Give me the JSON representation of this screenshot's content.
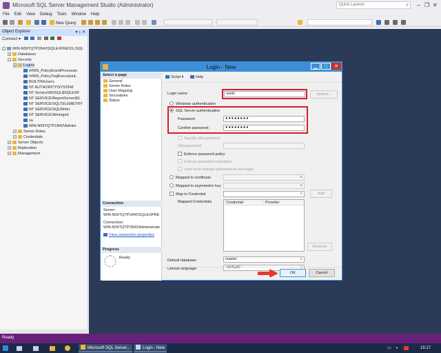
{
  "app": {
    "title": "Microsoft SQL Server Management Studio (Administrator)",
    "quick_launch_placeholder": "Quick Launch"
  },
  "menu": [
    "File",
    "Edit",
    "View",
    "Debug",
    "Tools",
    "Window",
    "Help"
  ],
  "toolbar": {
    "new_query_label": "New Query"
  },
  "object_explorer": {
    "title": "Object Explorer",
    "pin": "▾ ↨ ✕",
    "connect_label": "Connect ▾",
    "tree": [
      {
        "label": "WIN-N59TQTP1B42\\SQLEXPRESS (SQL",
        "indent": 0,
        "expander": "-",
        "icon": "server"
      },
      {
        "label": "Databases",
        "indent": 1,
        "expander": "+",
        "icon": "folder"
      },
      {
        "label": "Security",
        "indent": 1,
        "expander": "-",
        "icon": "folder"
      },
      {
        "label": "Logins",
        "indent": 2,
        "expander": "-",
        "icon": "folder",
        "selected": true
      },
      {
        "label": "##MS_PolicyEventProcessin",
        "indent": 3,
        "expander": "",
        "icon": "user"
      },
      {
        "label": "##MS_PolicyTsqlExecutionL",
        "indent": 3,
        "expander": "",
        "icon": "user"
      },
      {
        "label": "BUILTIN\\Users",
        "indent": 3,
        "expander": "",
        "icon": "user"
      },
      {
        "label": "NT AUTHORITY\\SYSTEM",
        "indent": 3,
        "expander": "",
        "icon": "user"
      },
      {
        "label": "NT Service\\MSSQL$SQLEXP",
        "indent": 3,
        "expander": "",
        "icon": "user"
      },
      {
        "label": "NT SERVICE\\ReportServer$S",
        "indent": 3,
        "expander": "",
        "icon": "user"
      },
      {
        "label": "NT SERVICE\\SQLTELEMETRY",
        "indent": 3,
        "expander": "",
        "icon": "user"
      },
      {
        "label": "NT SERVICE\\SQLWriter",
        "indent": 3,
        "expander": "",
        "icon": "user"
      },
      {
        "label": "NT SERVICE\\Winmgmt",
        "indent": 3,
        "expander": "",
        "icon": "user"
      },
      {
        "label": "sa",
        "indent": 3,
        "expander": "",
        "icon": "user"
      },
      {
        "label": "WIN-N59TQTP1B42\\Admini",
        "indent": 3,
        "expander": "",
        "icon": "user"
      },
      {
        "label": "Server Roles",
        "indent": 2,
        "expander": "+",
        "icon": "folder"
      },
      {
        "label": "Credentials",
        "indent": 2,
        "expander": "+",
        "icon": "folder"
      },
      {
        "label": "Server Objects",
        "indent": 1,
        "expander": "+",
        "icon": "folder"
      },
      {
        "label": "Replication",
        "indent": 1,
        "expander": "+",
        "icon": "folder"
      },
      {
        "label": "Management",
        "indent": 1,
        "expander": "+",
        "icon": "folder"
      }
    ]
  },
  "dialog": {
    "title": "Login - New",
    "select_page_header": "Select a page",
    "pages": [
      "General",
      "Server Roles",
      "User Mapping",
      "Securables",
      "Status"
    ],
    "script_label": "Script",
    "help_label": "Help",
    "connection_header": "Connection",
    "server_label": "Server:",
    "server_value": "WIN-N59TQTP1B42\\SQLEXPRE",
    "connection_label": "Connection:",
    "connection_value": "WIN-N59TQTP1B42\\Administrato",
    "view_props_link": "View connection properties",
    "progress_header": "Progress",
    "progress_status": "Ready",
    "login_name_label": "Login name:",
    "login_name_value": "ozeki",
    "search_button": "Search...",
    "windows_auth_label": "Windows authentication",
    "sql_auth_label": "SQL Server authentication",
    "password_label": "Password:",
    "password_value": "●●●●●●●●",
    "confirm_label": "Confirm password:",
    "confirm_value": "●●●●●●●●",
    "specify_old_label": "Specify old password",
    "old_password_label": "Old password:",
    "enforce_policy_label": "Enforce password policy",
    "enforce_expiration_label": "Enforce password expiration",
    "must_change_label": "User must change password at next login",
    "mapped_cert_label": "Mapped to certificate",
    "mapped_asym_label": "Mapped to asymmetric key",
    "map_credential_label": "Map to Credential",
    "add_button": "Add",
    "mapped_credentials_label": "Mapped Credentials",
    "col_credential": "Credential",
    "col_provider": "Provider",
    "remove_button": "Remove",
    "default_db_label": "Default database:",
    "default_db_value": "master",
    "default_lang_label": "Default language:",
    "default_lang_value": "<default>",
    "ok_button": "OK",
    "cancel_button": "Cancel"
  },
  "status": {
    "text": "Ready"
  },
  "taskbar": {
    "items": [
      "Microsoft SQL Server...",
      "Login - New"
    ],
    "clock": "15:17"
  },
  "colors": {
    "accent": "#3c8fd6",
    "highlight_red": "#d81b2b",
    "status_purple": "#68217a",
    "desktop": "#2b3a57"
  }
}
